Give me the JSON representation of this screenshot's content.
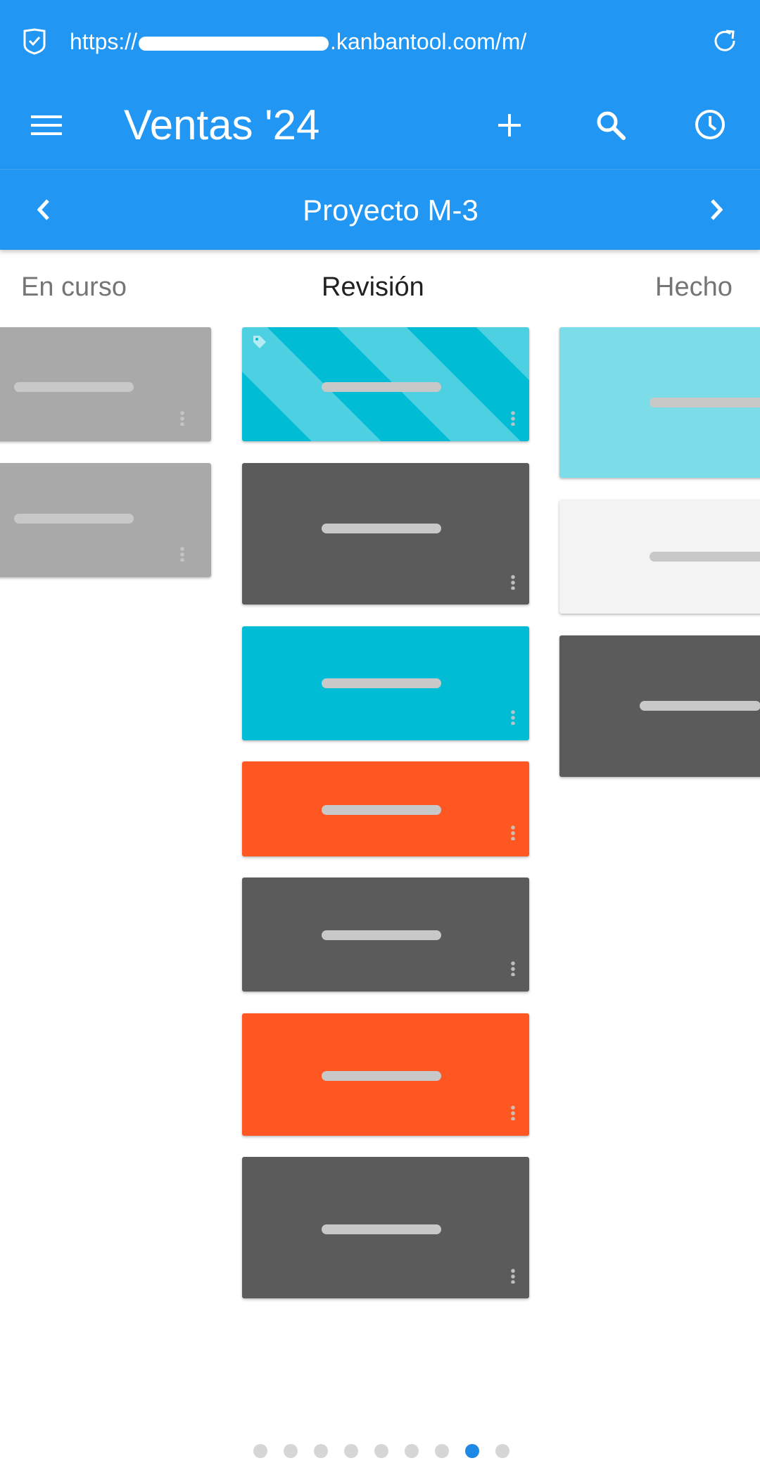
{
  "browser": {
    "url_prefix": "https://",
    "url_suffix": ".kanbantool.com/m/"
  },
  "header": {
    "title": "Ventas '24"
  },
  "swimlane": {
    "title": "Proyecto M-3"
  },
  "columns": [
    {
      "label": "En curso",
      "active": false
    },
    {
      "label": "Revisión",
      "active": true
    },
    {
      "label": "Hecho",
      "active": false
    }
  ],
  "cards": {
    "en_curso": [
      {
        "color": "#a9a9a9"
      },
      {
        "color": "#a9a9a9"
      }
    ],
    "revision": [
      {
        "color": "#00bcd4",
        "style": "striped",
        "icon": "tag-icon"
      },
      {
        "color": "#5b5b5b"
      },
      {
        "color": "#00bcd4"
      },
      {
        "color": "#ff5722"
      },
      {
        "color": "#5b5b5b"
      },
      {
        "color": "#ff5722"
      },
      {
        "color": "#5b5b5b"
      }
    ],
    "hecho": [
      {
        "color": "#7cdce8"
      },
      {
        "color": "#f3f3f3"
      },
      {
        "color": "#5b5b5b"
      }
    ]
  },
  "pager": {
    "pages": 9,
    "current": 8
  },
  "colors": {
    "primary": "#2196f3",
    "pager_active": "#1e88e5"
  }
}
